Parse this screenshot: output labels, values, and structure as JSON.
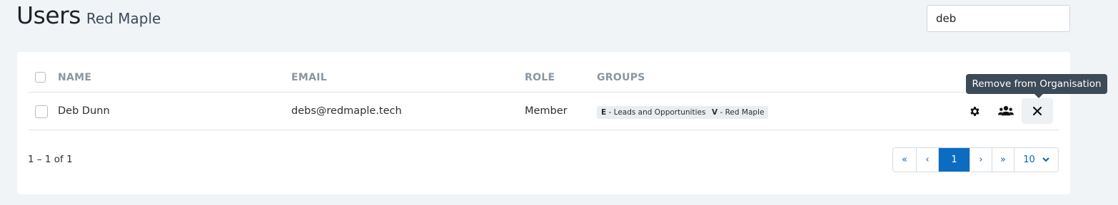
{
  "header": {
    "title": "Users",
    "subtitle": "Red Maple"
  },
  "search": {
    "value": "deb"
  },
  "table": {
    "columns": [
      "NAME",
      "EMAIL",
      "ROLE",
      "GROUPS"
    ],
    "rows": [
      {
        "name": "Deb Dunn",
        "email": "debs@redmaple.tech",
        "role": "Member",
        "groups": [
          {
            "prefix": "E",
            "label": " - Leads and Opportunities"
          },
          {
            "prefix": "V",
            "label": " - Red Maple"
          }
        ]
      }
    ]
  },
  "actions": {
    "settings_icon": "gear-icon",
    "groups_icon": "users-icon",
    "remove_icon": "close-icon"
  },
  "tooltip": {
    "text": "Remove from Organisation"
  },
  "pagination": {
    "summary": "1 – 1 of 1",
    "first": "«",
    "prev": "‹",
    "current": "1",
    "next": "›",
    "last": "»",
    "page_size": "10"
  },
  "colors": {
    "accent": "#0b6cc1",
    "tooltip_bg": "#3d4a58",
    "background": "#f1f4f7"
  }
}
